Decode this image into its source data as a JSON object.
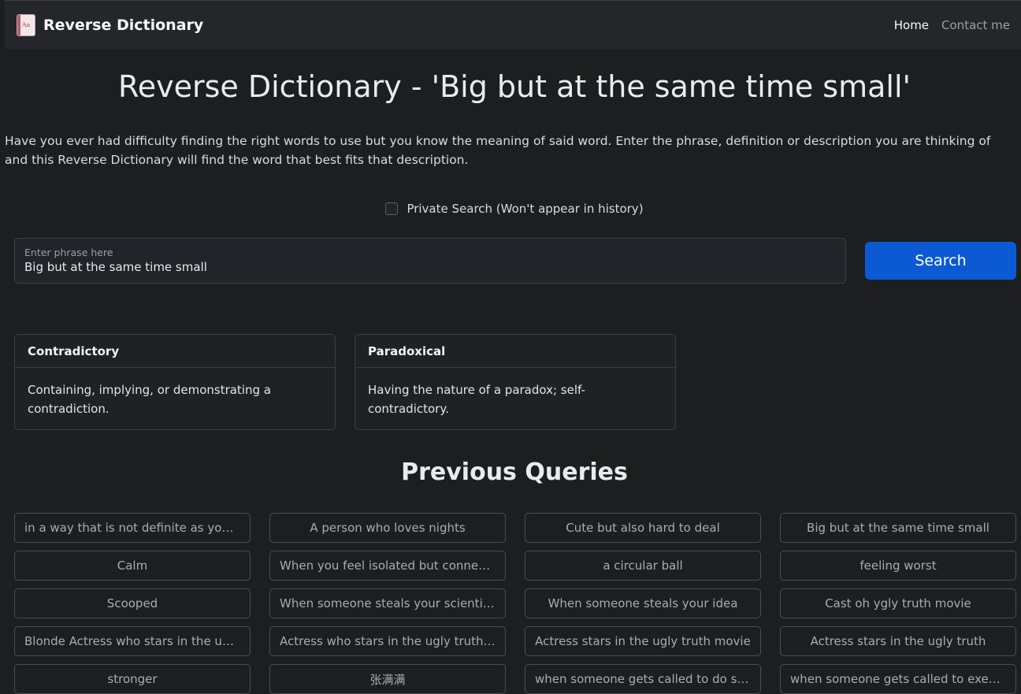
{
  "navbar": {
    "brand": "Reverse Dictionary",
    "links": [
      {
        "label": "Home",
        "active": true
      },
      {
        "label": "Contact me",
        "active": false
      }
    ]
  },
  "page": {
    "title": "Reverse Dictionary - 'Big but at the same time small'",
    "description": "Have you ever had difficulty finding the right words to use but you know the meaning of said word. Enter the phrase, definition or description you are thinking of and this Reverse Dictionary will find the word that best fits that description.",
    "private_label": "Private Search (Won't appear in history)",
    "private_checked": false
  },
  "search": {
    "placeholder": "Enter phrase here",
    "value": "Big but at the same time small",
    "button_label": "Search"
  },
  "results": [
    {
      "word": "Contradictory",
      "definition": "Containing, implying, or demonstrating a contradiction."
    },
    {
      "word": "Paradoxical",
      "definition": "Having the nature of a paradox; self-contradictory."
    }
  ],
  "previous": {
    "title": "Previous Queries",
    "items": [
      "in a way that is not definite as you m...",
      "A person who loves nights",
      "Cute but also hard to deal",
      "Big but at the same time small",
      "Calm",
      "When you feel isolated but connecte...",
      "a circular ball",
      "feeling worst",
      "Scooped",
      "When someone steals your scientific ...",
      "When someone steals your idea",
      "Cast oh ygly truth movie",
      "Blonde Actress who stars in the ugly ...",
      "Actress who stars in the ugly truth m...",
      "Actress stars in the ugly truth movie",
      "Actress stars in the ugly truth",
      "stronger",
      "张满满",
      "when someone gets called to do so...",
      "when someone gets called to execut..."
    ]
  },
  "colors": {
    "background": "#1d1e20",
    "navbar": "#24262a",
    "primary_button": "#0b5ad4"
  }
}
